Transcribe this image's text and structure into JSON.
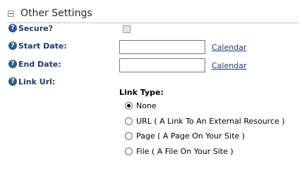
{
  "section": {
    "title": "Other Settings",
    "collapse_icon": "minus-box-icon"
  },
  "fields": {
    "secure": {
      "label": "Secure?",
      "checked": false,
      "disabled": true
    },
    "start_date": {
      "label": "Start Date:",
      "value": "",
      "link": "Calendar"
    },
    "end_date": {
      "label": "End Date:",
      "value": "",
      "link": "Calendar"
    },
    "link_url": {
      "label": "Link Url:"
    }
  },
  "link_type": {
    "label": "Link Type:",
    "options": [
      {
        "label": "None",
        "selected": true
      },
      {
        "label": "URL ( A Link To An External Resource )",
        "selected": false
      },
      {
        "label": "Page ( A Page On Your Site )",
        "selected": false
      },
      {
        "label": "File ( A File On Your Site )",
        "selected": false
      }
    ]
  },
  "help_icon_glyph": "?",
  "colors": {
    "label": "#1e3a6e",
    "link": "#1c3d78",
    "help_icon": "#2b5d8c",
    "divider": "#c5c5c5"
  }
}
